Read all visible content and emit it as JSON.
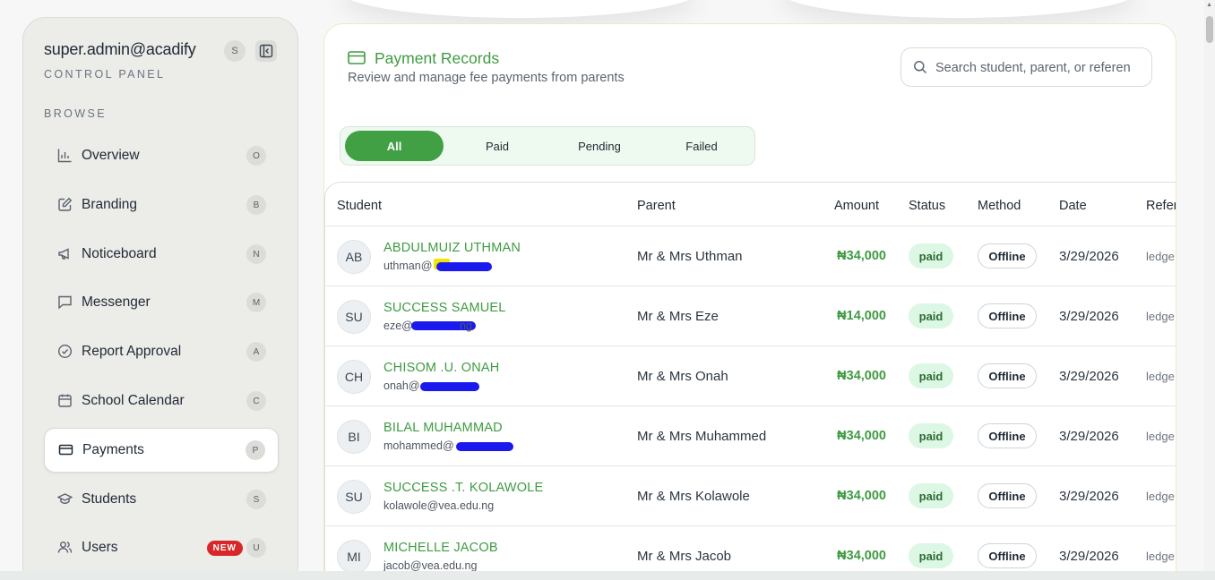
{
  "sidebar": {
    "account": "super.admin@acadify",
    "account_badge": "S",
    "subtitle": "CONTROL PANEL",
    "section": "BROWSE",
    "items": [
      {
        "label": "Overview",
        "key": "O",
        "icon": "bar-chart-icon"
      },
      {
        "label": "Branding",
        "key": "B",
        "icon": "edit-icon"
      },
      {
        "label": "Noticeboard",
        "key": "N",
        "icon": "megaphone-icon"
      },
      {
        "label": "Messenger",
        "key": "M",
        "icon": "message-icon"
      },
      {
        "label": "Report Approval",
        "key": "A",
        "icon": "check-circle-icon"
      },
      {
        "label": "School Calendar",
        "key": "C",
        "icon": "calendar-icon"
      },
      {
        "label": "Payments",
        "key": "P",
        "icon": "credit-card-icon",
        "active": true
      },
      {
        "label": "Students",
        "key": "S",
        "icon": "graduation-cap-icon"
      },
      {
        "label": "Users",
        "key": "U",
        "icon": "users-icon",
        "tag": "NEW"
      }
    ]
  },
  "header": {
    "title": "Payment Records",
    "subtitle": "Review and manage fee payments from parents",
    "search_placeholder": "Search student, parent, or referen"
  },
  "filters": [
    "All",
    "Paid",
    "Pending",
    "Failed"
  ],
  "active_filter": "All",
  "table": {
    "columns": [
      "Student",
      "Parent",
      "Amount",
      "Status",
      "Method",
      "Date",
      "Refer"
    ],
    "rows": [
      {
        "initials": "AB",
        "name": "ABDULMUIZ UTHMAN",
        "email": "uthman@",
        "parent": "Mr & Mrs Uthman",
        "amount": "₦34,000",
        "status": "paid",
        "method": "Offline",
        "date": "3/29/2026",
        "ref": "ledge"
      },
      {
        "initials": "SU",
        "name": "SUCCESS SAMUEL",
        "email": "eze@",
        "email_tail": "ng",
        "parent": "Mr & Mrs Eze",
        "amount": "₦14,000",
        "status": "paid",
        "method": "Offline",
        "date": "3/29/2026",
        "ref": "ledge"
      },
      {
        "initials": "CH",
        "name": "CHISOM .U. ONAH",
        "email": "onah@",
        "parent": "Mr & Mrs Onah",
        "amount": "₦34,000",
        "status": "paid",
        "method": "Offline",
        "date": "3/29/2026",
        "ref": "ledge"
      },
      {
        "initials": "BI",
        "name": "BILAL MUHAMMAD",
        "email": "mohammed@",
        "parent": "Mr & Mrs Muhammed",
        "amount": "₦34,000",
        "status": "paid",
        "method": "Offline",
        "date": "3/29/2026",
        "ref": "ledge"
      },
      {
        "initials": "SU",
        "name": "SUCCESS .T. KOLAWOLE",
        "email": "kolawole@vea.edu.ng",
        "parent": "Mr & Mrs Kolawole",
        "amount": "₦34,000",
        "status": "paid",
        "method": "Offline",
        "date": "3/29/2026",
        "ref": "ledge"
      },
      {
        "initials": "MI",
        "name": "MICHELLE JACOB",
        "email": "jacob@vea.edu.ng",
        "parent": "Mr & Mrs Jacob",
        "amount": "₦34,000",
        "status": "paid",
        "method": "Offline",
        "date": "3/29/2026",
        "ref": "ledge"
      }
    ]
  },
  "colors": {
    "accent": "#40a043",
    "accent_text": "#3f9b42",
    "new_tag": "#d62828",
    "paid_bg": "#dcf7e4"
  }
}
